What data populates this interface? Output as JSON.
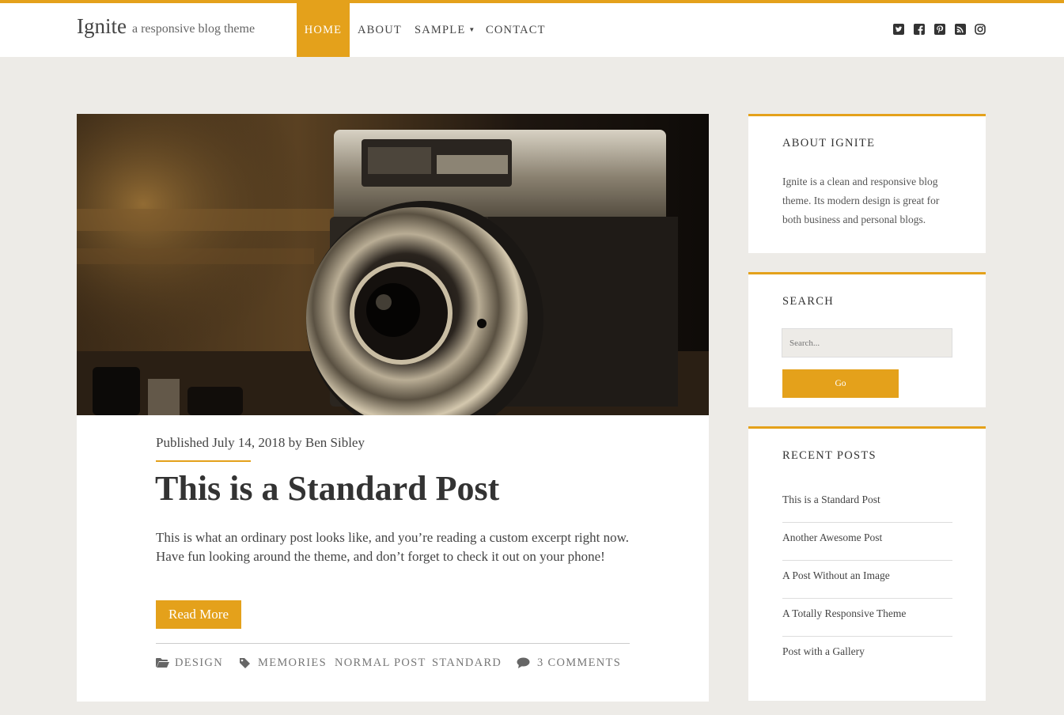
{
  "site": {
    "title": "Ignite",
    "tagline": "a responsive blog theme"
  },
  "nav": [
    {
      "label": "HOME",
      "active": true
    },
    {
      "label": "ABOUT"
    },
    {
      "label": "SAMPLE",
      "has_dropdown": true
    },
    {
      "label": "CONTACT"
    }
  ],
  "social_icons": [
    "twitter-icon",
    "facebook-icon",
    "pinterest-icon",
    "rss-icon",
    "instagram-icon"
  ],
  "post": {
    "meta": "Published July 14, 2018 by Ben Sibley",
    "title": "This is a Standard Post",
    "excerpt": "This is what an ordinary post looks like, and you’re reading a custom excerpt right now. Have fun looking around the theme, and don’t forget to check it out on your phone!",
    "read_more": "Read More",
    "category": "DESIGN",
    "tags": [
      "MEMORIES",
      "NORMAL POST",
      "STANDARD"
    ],
    "comments": "3 COMMENTS",
    "featured_image": "vintage-camera-photo"
  },
  "sidebar": {
    "about": {
      "title": "ABOUT IGNITE",
      "text": "Ignite is a clean and responsive blog theme. Its modern design is great for both business and personal blogs."
    },
    "search": {
      "title": "SEARCH",
      "placeholder": "Search...",
      "button": "Go"
    },
    "recent": {
      "title": "RECENT POSTS",
      "items": [
        "This is a Standard Post",
        "Another Awesome Post",
        "A Post Without an Image",
        "A Totally Responsive Theme",
        "Post with a Gallery"
      ]
    }
  },
  "colors": {
    "accent": "#e4a11b",
    "background": "#edebe7"
  }
}
